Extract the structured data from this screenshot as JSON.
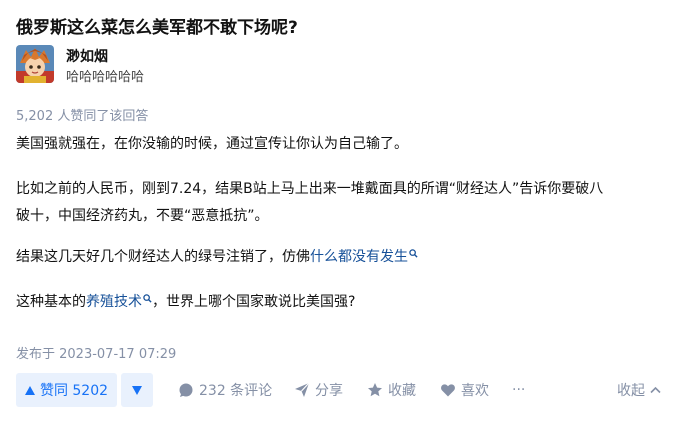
{
  "question": {
    "title": "俄罗斯这么菜怎么美军都不敢下场呢?"
  },
  "author": {
    "name": "渺如烟",
    "bio": "哈哈哈哈哈哈"
  },
  "answer": {
    "upvote_summary": "5,202 人赞同了该回答",
    "p1": "美国强就强在，在你没输的时候，通过宣传让你认为自己输了。",
    "p2_line1": "比如之前的人民币，刚到7.24，结果B站上马上出来一堆戴面具的所谓“财经达人”告诉你要破八",
    "p2_line2": "破十，中国经济药丸，不要“恶意抵抗”。",
    "p3_text": "结果这几天好几个财经达人的绿号注销了，仿佛",
    "p3_link": "什么都没有发生",
    "p4_before": "这种基本的",
    "p4_link": "养殖技术",
    "p4_after": "，世界上哪个国家敢说比美国强?",
    "publish_time": "发布于 2023-07-17 07:29"
  },
  "actions": {
    "upvote_label": "赞同 5202",
    "comments_label": "232 条评论",
    "share_label": "分享",
    "favorite_label": "收藏",
    "like_label": "喜欢",
    "more_label": "···",
    "collapse_label": "收起"
  },
  "colors": {
    "link": "#175199",
    "accent": "#1772f6",
    "accent_bg": "#e9f1fd",
    "muted": "#8590a6"
  },
  "icons": [
    "search-icon",
    "upvote-triangle-icon",
    "downvote-triangle-icon",
    "comment-bubble-icon",
    "paper-plane-icon",
    "star-icon",
    "heart-icon",
    "chevron-up-icon"
  ]
}
